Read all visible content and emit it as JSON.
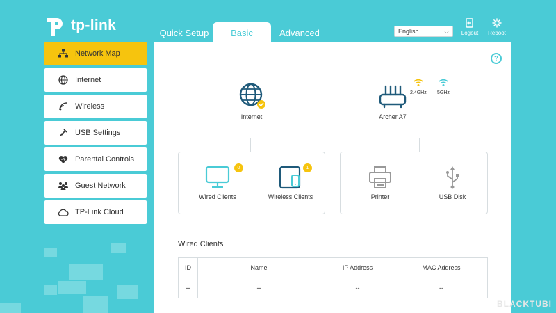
{
  "brand": {
    "logo_text": "tp-link"
  },
  "nav": {
    "tabs": [
      {
        "label": "Quick Setup"
      },
      {
        "label": "Basic"
      },
      {
        "label": "Advanced"
      }
    ]
  },
  "language": {
    "selected": "English"
  },
  "actions": {
    "logout": "Logout",
    "reboot": "Reboot"
  },
  "sidebar": {
    "items": [
      {
        "label": "Network Map",
        "icon": "network-map-icon",
        "active": true
      },
      {
        "label": "Internet",
        "icon": "globe-icon"
      },
      {
        "label": "Wireless",
        "icon": "wifi-icon"
      },
      {
        "label": "USB Settings",
        "icon": "usb-settings-icon"
      },
      {
        "label": "Parental Controls",
        "icon": "heart-icon"
      },
      {
        "label": "Guest Network",
        "icon": "guest-icon"
      },
      {
        "label": "TP-Link Cloud",
        "icon": "cloud-icon"
      }
    ]
  },
  "map": {
    "internet_label": "Internet",
    "router_label": "Archer A7",
    "band_24": "2.4GHz",
    "band_5": "5GHz",
    "clients": [
      {
        "label": "Wired Clients",
        "count": "0"
      },
      {
        "label": "Wireless Clients",
        "count": "1"
      }
    ],
    "usb": [
      {
        "label": "Printer"
      },
      {
        "label": "USB Disk"
      }
    ]
  },
  "wired_clients": {
    "title": "Wired Clients",
    "columns": [
      "ID",
      "Name",
      "IP Address",
      "MAC Address"
    ],
    "rows": [
      [
        "--",
        "--",
        "--",
        "--"
      ]
    ]
  },
  "colors": {
    "accent": "#4acbd6",
    "active": "#f6c40e"
  },
  "watermark": "BLACKTUBI"
}
